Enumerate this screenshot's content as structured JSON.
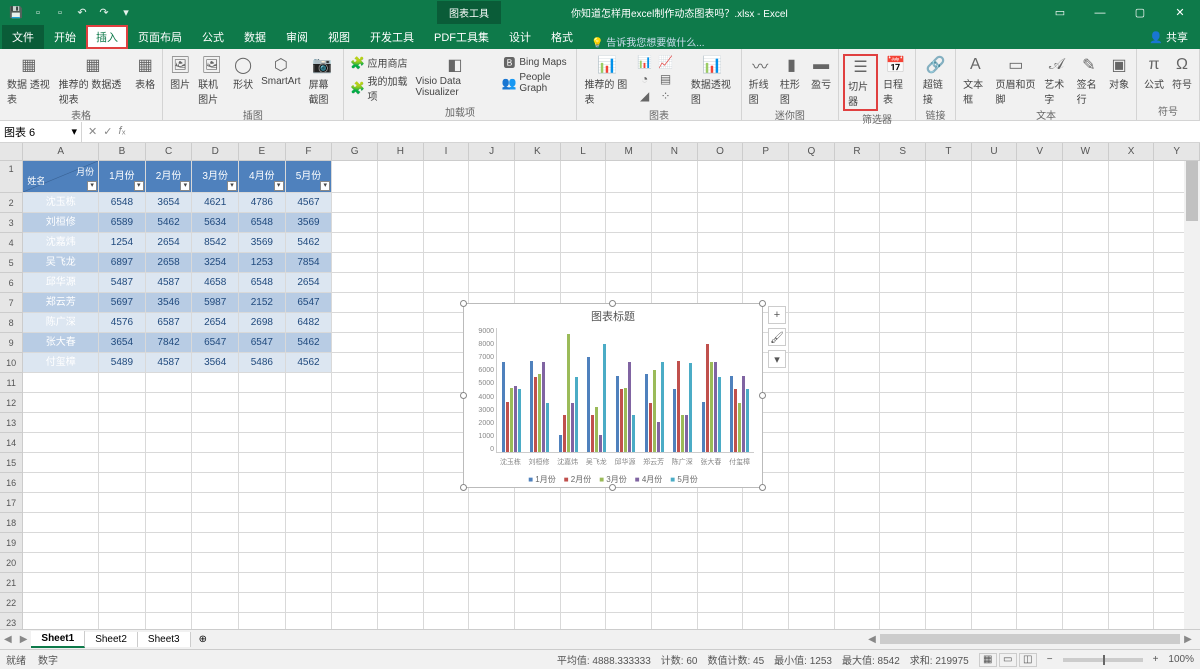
{
  "app": {
    "context_tab": "图表工具",
    "doc_title": "你知道怎样用excel制作动态图表吗？.xlsx - Excel"
  },
  "window": {
    "share": "共享"
  },
  "tabs": {
    "file": "文件",
    "home": "开始",
    "insert": "插入",
    "layout": "页面布局",
    "formulas": "公式",
    "data": "数据",
    "review": "审阅",
    "view": "视图",
    "dev": "开发工具",
    "pdf": "PDF工具集",
    "design": "设计",
    "format": "格式",
    "tell": "告诉我您想要做什么..."
  },
  "ribbon": {
    "g_tables": "表格",
    "pivot": "数据\n透视表",
    "rec_pivot": "推荐的\n数据透视表",
    "table": "表格",
    "g_illust": "插图",
    "pic": "图片",
    "online_pic": "联机图片",
    "shapes": "形状",
    "smartart": "SmartArt",
    "screenshot": "屏幕截图",
    "g_addins": "加载项",
    "store": "应用商店",
    "myaddins": "我的加载项",
    "bing": "Bing Maps",
    "visio": "Visio Data\nVisualizer",
    "people": "People Graph",
    "g_charts": "图表",
    "rec_chart": "推荐的\n图表",
    "pivot_chart": "数据透视图",
    "g_spark": "迷你图",
    "spark_line": "折线图",
    "spark_col": "柱形图",
    "spark_wl": "盈亏",
    "g_filter": "筛选器",
    "slicer": "切片器",
    "timeline": "日程表",
    "g_link": "链接",
    "hyperlink": "超链接",
    "g_text": "文本",
    "textbox": "文本框",
    "hf": "页眉和页脚",
    "wordart": "艺术字",
    "sigline": "签名行",
    "object": "对象",
    "g_sym": "符号",
    "eq": "公式",
    "sym": "符号"
  },
  "namebox": "图表 6",
  "table": {
    "corner_top": "月份",
    "corner_left": "姓名",
    "months": [
      "1月份",
      "2月份",
      "3月份",
      "4月份",
      "5月份"
    ],
    "rows": [
      {
        "name": "沈玉栋",
        "v": [
          6548,
          3654,
          4621,
          4786,
          4567
        ]
      },
      {
        "name": "刘桓修",
        "v": [
          6589,
          5462,
          5634,
          6548,
          3569
        ]
      },
      {
        "name": "沈嘉炜",
        "v": [
          1254,
          2654,
          8542,
          3569,
          5462
        ]
      },
      {
        "name": "吴飞龙",
        "v": [
          6897,
          2658,
          3254,
          1253,
          7854
        ]
      },
      {
        "name": "邱华源",
        "v": [
          5487,
          4587,
          4658,
          6548,
          2654
        ]
      },
      {
        "name": "郑云芳",
        "v": [
          5697,
          3546,
          5987,
          2152,
          6547
        ]
      },
      {
        "name": "陈广深",
        "v": [
          4576,
          6587,
          2654,
          2698,
          6482
        ]
      },
      {
        "name": "张大春",
        "v": [
          3654,
          7842,
          6547,
          6547,
          5462
        ]
      },
      {
        "name": "付玺樟",
        "v": [
          5489,
          4587,
          3564,
          5486,
          4562
        ]
      }
    ]
  },
  "chart_data": {
    "type": "bar",
    "title": "图表标题",
    "categories": [
      "沈玉栋",
      "刘桓修",
      "沈嘉炜",
      "吴飞龙",
      "邱华源",
      "郑云芳",
      "陈广深",
      "张大春",
      "付玺樟"
    ],
    "series": [
      {
        "name": "1月份",
        "values": [
          6548,
          6589,
          1254,
          6897,
          5487,
          5697,
          4576,
          3654,
          5489
        ]
      },
      {
        "name": "2月份",
        "values": [
          3654,
          5462,
          2654,
          2658,
          4587,
          3546,
          6587,
          7842,
          4587
        ]
      },
      {
        "name": "3月份",
        "values": [
          4621,
          5634,
          8542,
          3254,
          4658,
          5987,
          2654,
          6547,
          3564
        ]
      },
      {
        "name": "4月份",
        "values": [
          4786,
          6548,
          3569,
          1253,
          6548,
          2152,
          2698,
          6547,
          5486
        ]
      },
      {
        "name": "5月份",
        "values": [
          4567,
          3569,
          5462,
          7854,
          2654,
          6547,
          6482,
          5462,
          4562
        ]
      }
    ],
    "ylim": [
      0,
      9000
    ],
    "yticks": [
      0,
      1000,
      2000,
      3000,
      4000,
      5000,
      6000,
      7000,
      8000,
      9000
    ]
  },
  "sheets": [
    "Sheet1",
    "Sheet2",
    "Sheet3"
  ],
  "status": {
    "ready": "就绪",
    "num": "数字",
    "avg_label": "平均值:",
    "avg": "4888.333333",
    "count_label": "计数:",
    "count": "60",
    "ncount_label": "数值计数:",
    "ncount": "45",
    "min_label": "最小值:",
    "min": "1253",
    "max_label": "最大值:",
    "max": "8542",
    "sum_label": "求和:",
    "sum": "219975",
    "zoom": "100%"
  },
  "columns": [
    "A",
    "B",
    "C",
    "D",
    "E",
    "F",
    "G",
    "H",
    "I",
    "J",
    "K",
    "L",
    "M",
    "N",
    "O",
    "P",
    "Q",
    "R",
    "S",
    "T",
    "U",
    "V",
    "W",
    "X",
    "Y"
  ]
}
